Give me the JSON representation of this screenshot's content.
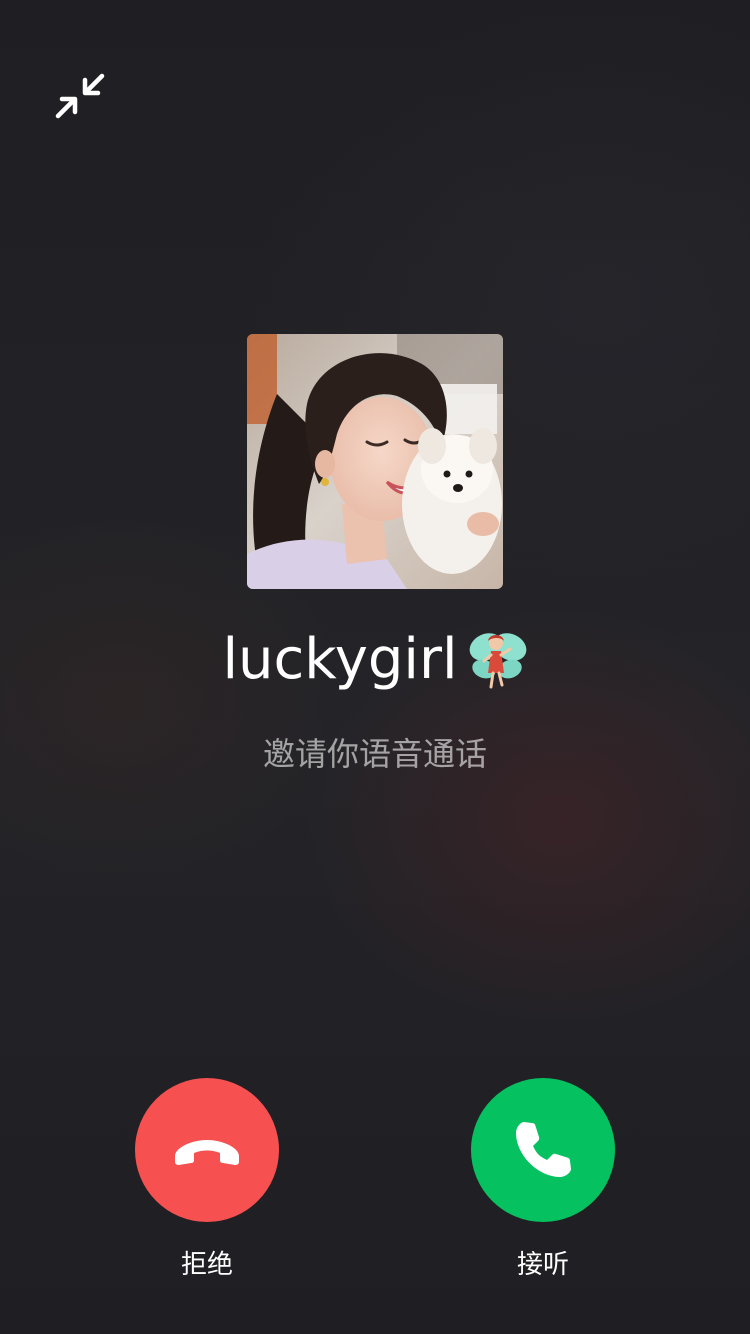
{
  "caller": {
    "name": "luckygirl",
    "name_emoji": "fairy-emoji",
    "status_text": "邀请你语音通话"
  },
  "controls": {
    "minimize_icon": "minimize-arrows-icon",
    "decline_label": "拒绝",
    "accept_label": "接听",
    "decline_icon": "phone-hangup-icon",
    "accept_icon": "phone-icon"
  },
  "colors": {
    "background": "#222226",
    "decline": "#f65050",
    "accept": "#06c160"
  }
}
